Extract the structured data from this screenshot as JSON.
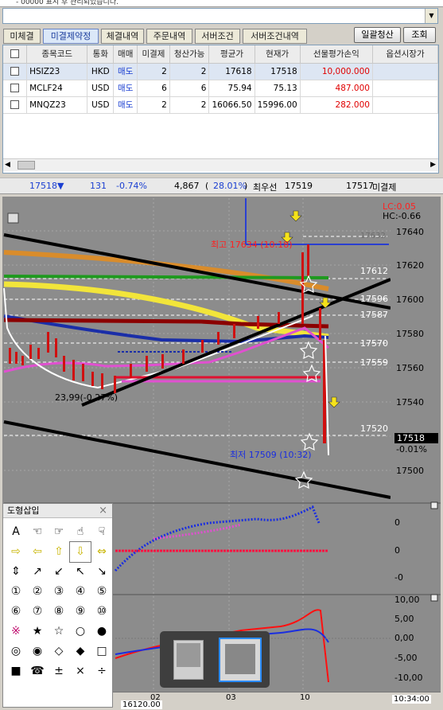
{
  "top_text": "- 00000    표시 후 관리되었습니다.",
  "tabs": [
    "미체결",
    "미결제약정",
    "체결내역",
    "주문내역",
    "서버조건",
    "서버조건내역"
  ],
  "active_tab": 1,
  "buttons": {
    "liquidate": "일괄청산",
    "query": "조회"
  },
  "table": {
    "headers": [
      "종목코드",
      "통화",
      "매매",
      "미결제",
      "청산가능",
      "평균가",
      "현재가",
      "선물평가손익",
      "옵션시장가"
    ],
    "rows": [
      {
        "code": "HSIZ23",
        "currency": "HKD",
        "side": "매도",
        "open": "2",
        "closable": "2",
        "avg": "17618",
        "current": "17518",
        "pnl": "10,000.000"
      },
      {
        "code": "MCLF24",
        "currency": "USD",
        "side": "매도",
        "open": "6",
        "closable": "6",
        "avg": "75.94",
        "current": "75.13",
        "pnl": "487.000"
      },
      {
        "code": "MNQZ23",
        "currency": "USD",
        "side": "매도",
        "open": "2",
        "closable": "2",
        "avg": "16066.50",
        "current": "15996.00",
        "pnl": "282.000"
      }
    ]
  },
  "info": {
    "price": "17518▼",
    "change": "131",
    "rate": "-0.74%",
    "volume": "4,867",
    "pct": "28.01%",
    "best_label": "최우선",
    "best": "17519",
    "bid": "17517",
    "status": "미결제"
  },
  "chart": {
    "price_labels": [
      "17640",
      "17620",
      "17600",
      "17580",
      "17560",
      "17540",
      "17520",
      "17500"
    ],
    "hline_labels": [
      "17632",
      "17612",
      "17596",
      "17587",
      "17570",
      "17559",
      "17520"
    ],
    "current_label": "17518",
    "current_pct": "-0.01%",
    "lc": "LC:0.05",
    "hc": "HC:-0.66",
    "high_note": "최고 17634 (10:18)",
    "low_note": "최저 17509 (10:32)",
    "left_note": "23,99(-0.27%)",
    "ind1_labels": [
      "0",
      "0",
      "-0"
    ],
    "ind2_labels": [
      "10,00",
      "5,00",
      "0,00",
      "-5,00",
      "-10,00"
    ],
    "time_labels": [
      "02",
      "03",
      "10"
    ],
    "bottom_val": "16120.00",
    "bottom_time": "10:34:00"
  },
  "palette": {
    "title": "도형삽입",
    "close": "×",
    "cells": [
      "A",
      "☜",
      "☞",
      "☝",
      "☟",
      "⇨",
      "⇦",
      "⇧",
      "⇩",
      "⇔",
      "⇕",
      "↗",
      "↙",
      "↖",
      "↘",
      "①",
      "②",
      "③",
      "④",
      "⑤",
      "⑥",
      "⑦",
      "⑧",
      "⑨",
      "⑩",
      "※",
      "★",
      "☆",
      "○",
      "●",
      "◎",
      "◉",
      "◇",
      "◆",
      "□",
      "■",
      "☎",
      "±",
      "×",
      "÷"
    ]
  }
}
